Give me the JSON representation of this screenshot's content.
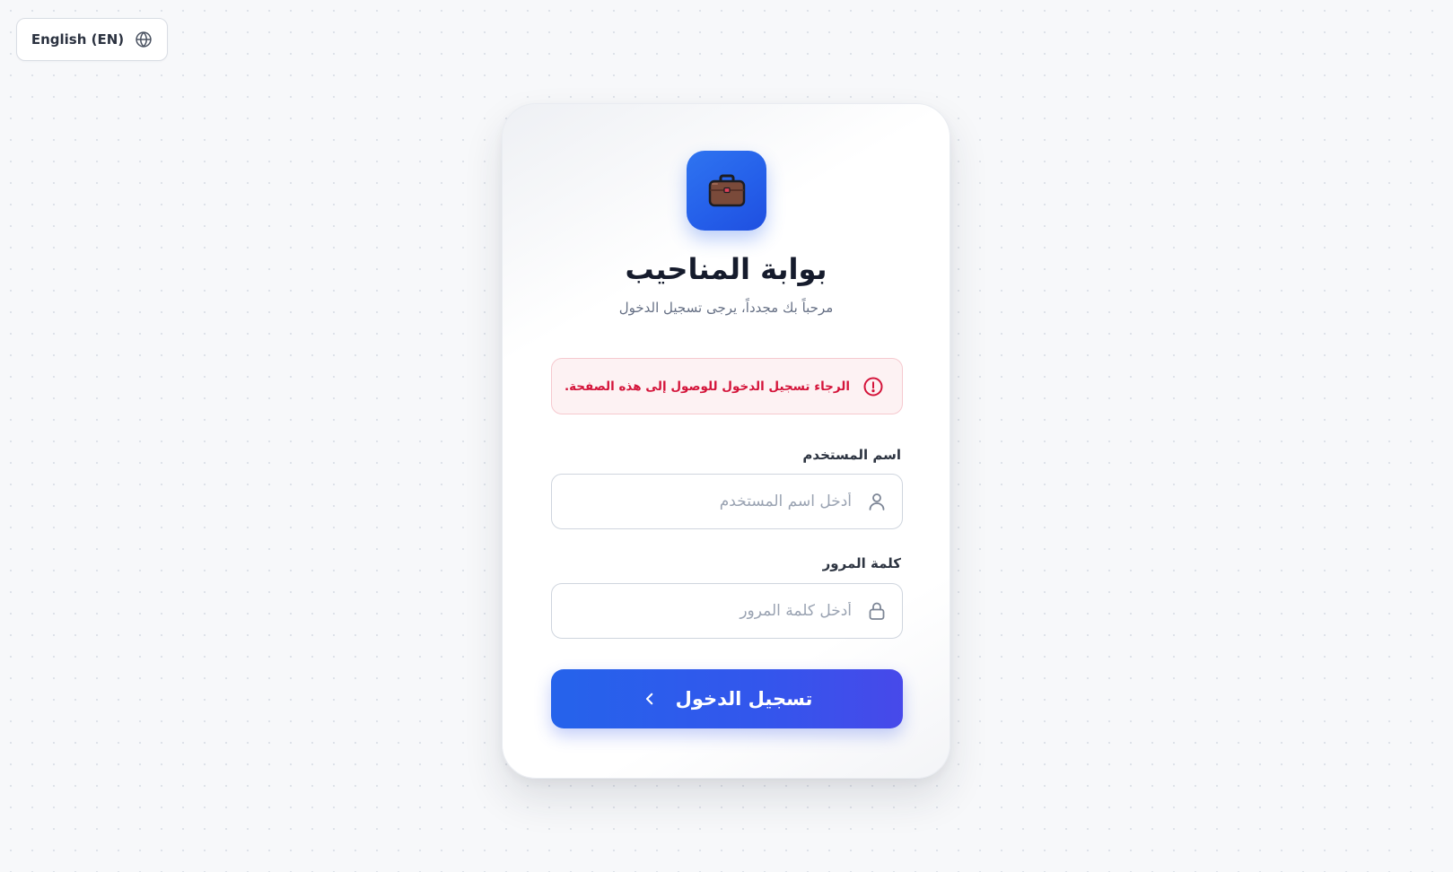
{
  "language_switcher": {
    "label": "English (EN)",
    "icon": "globe-icon"
  },
  "login_card": {
    "logo_icon": "briefcase-icon",
    "title": "بوابة المناحيب",
    "subtitle": "مرحباً بك مجدداً، يرجى تسجيل الدخول",
    "alert": {
      "icon": "alert-circle-icon",
      "message": "الرجاء تسجيل الدخول للوصول إلى هذه الصفحة.",
      "color": "#d4143a"
    },
    "username": {
      "label": "اسم المستخدم",
      "placeholder": "أدخل اسم المستخدم",
      "value": "",
      "icon": "user-icon"
    },
    "password": {
      "label": "كلمة المرور",
      "placeholder": "أدخل كلمة المرور",
      "value": "",
      "icon": "lock-icon"
    },
    "submit": {
      "label": "تسجيل الدخول",
      "icon": "chevron-left-icon"
    }
  },
  "colors": {
    "accent": "#2563eb",
    "error": "#d4143a",
    "title": "#151b2c",
    "background": "#f7f8fa"
  }
}
